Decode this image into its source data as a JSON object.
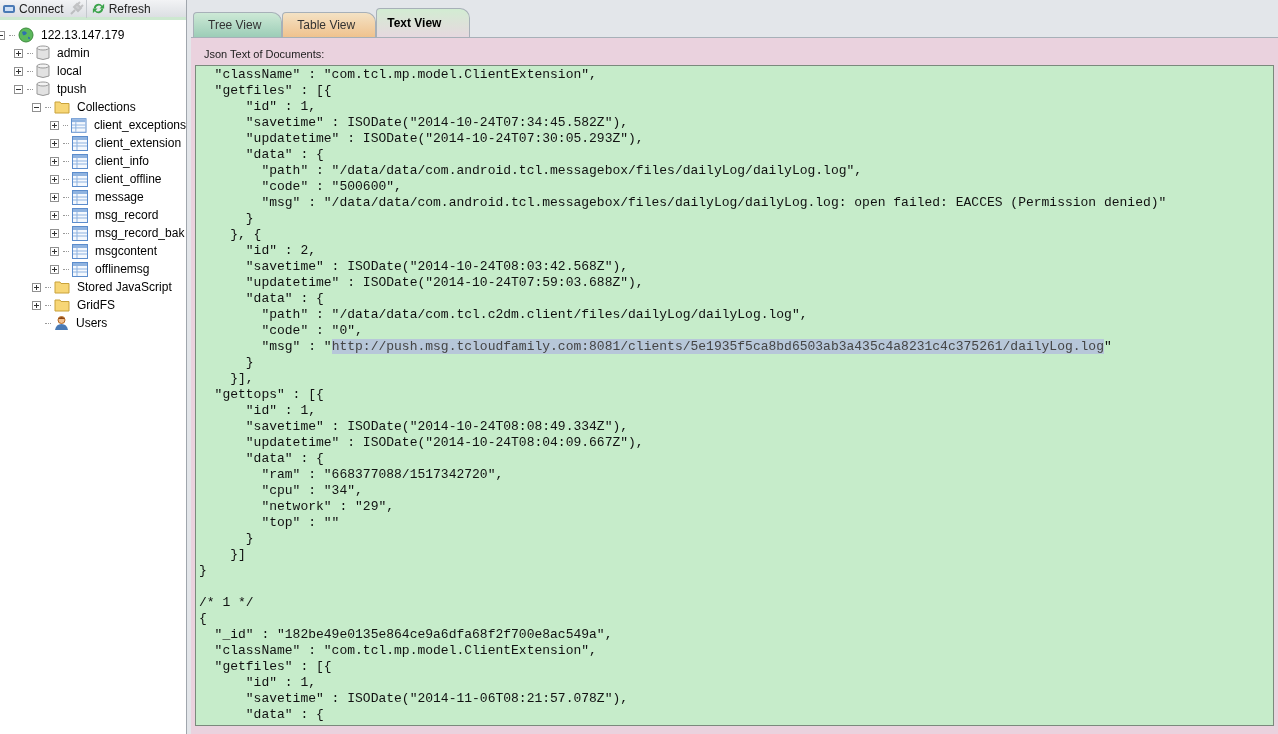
{
  "toolbar": [
    {
      "kind": "connect",
      "label": "Connect",
      "disabled": false
    },
    {
      "kind": "disconnect",
      "disabled": true
    },
    {
      "kind": "refresh",
      "label": "Refresh",
      "disabled": false
    }
  ],
  "tree": [
    {
      "label": "122.13.147.179",
      "kind": "server",
      "expanded": true,
      "children": [
        {
          "label": "admin",
          "kind": "database",
          "expanded": false
        },
        {
          "label": "local",
          "kind": "database",
          "expanded": false
        },
        {
          "label": "tpush",
          "kind": "database",
          "expanded": true,
          "children": [
            {
              "label": "Collections",
              "kind": "folder",
              "expanded": true,
              "children": [
                {
                  "label": "client_exceptions",
                  "kind": "collection",
                  "expanded": false
                },
                {
                  "label": "client_extension",
                  "kind": "collection",
                  "expanded": false
                },
                {
                  "label": "client_info",
                  "kind": "collection",
                  "expanded": false
                },
                {
                  "label": "client_offline",
                  "kind": "collection",
                  "expanded": false
                },
                {
                  "label": "message",
                  "kind": "collection",
                  "expanded": false
                },
                {
                  "label": "msg_record",
                  "kind": "collection",
                  "expanded": false
                },
                {
                  "label": "msg_record_bak",
                  "kind": "collection",
                  "expanded": false
                },
                {
                  "label": "msgcontent",
                  "kind": "collection",
                  "expanded": false
                },
                {
                  "label": "offlinemsg",
                  "kind": "collection",
                  "expanded": false
                }
              ]
            },
            {
              "label": "Stored JavaScript",
              "kind": "folder",
              "expanded": false
            },
            {
              "label": "GridFS",
              "kind": "folder",
              "expanded": false
            },
            {
              "label": "Users",
              "kind": "users"
            }
          ]
        }
      ]
    }
  ],
  "tabs": [
    {
      "label": "Tree View",
      "kind": "tree",
      "selected": false
    },
    {
      "label": "Table View",
      "kind": "table",
      "selected": false
    },
    {
      "label": "Text View",
      "kind": "text",
      "selected": true
    }
  ],
  "panel_label": "Json Text of Documents:",
  "lines": [
    {
      "text": "  \"className\" : \"com.tcl.mp.model.ClientExtension\","
    },
    {
      "text": "  \"getfiles\" : [{"
    },
    {
      "text": "      \"id\" : 1,"
    },
    {
      "text": "      \"savetime\" : ISODate(\"2014-10-24T07:34:45.582Z\"),"
    },
    {
      "text": "      \"updatetime\" : ISODate(\"2014-10-24T07:30:05.293Z\"),"
    },
    {
      "text": "      \"data\" : {"
    },
    {
      "text": "        \"path\" : \"/data/data/com.android.tcl.messagebox/files/dailyLog/dailyLog.log\","
    },
    {
      "text": "        \"code\" : \"500600\","
    },
    {
      "text": "        \"msg\" : \"/data/data/com.android.tcl.messagebox/files/dailyLog/dailyLog.log: open failed: EACCES (Permission denied)\""
    },
    {
      "text": "      }"
    },
    {
      "text": "    }, {"
    },
    {
      "text": "      \"id\" : 2,"
    },
    {
      "text": "      \"savetime\" : ISODate(\"2014-10-24T08:03:42.568Z\"),"
    },
    {
      "text": "      \"updatetime\" : ISODate(\"2014-10-24T07:59:03.688Z\"),"
    },
    {
      "text": "      \"data\" : {"
    },
    {
      "text": "        \"path\" : \"/data/data/com.tcl.c2dm.client/files/dailyLog/dailyLog.log\","
    },
    {
      "text": "        \"code\" : \"0\","
    },
    {
      "text": "        \"msg\" : \"",
      "selection": "http://push.msg.tcloudfamily.com:8081/clients/5e1935f5ca8bd6503ab3a435c4a8231c4c375261/dailyLog.log",
      "after": "\""
    },
    {
      "text": "      }"
    },
    {
      "text": "    }],"
    },
    {
      "text": "  \"gettops\" : [{"
    },
    {
      "text": "      \"id\" : 1,"
    },
    {
      "text": "      \"savetime\" : ISODate(\"2014-10-24T08:08:49.334Z\"),"
    },
    {
      "text": "      \"updatetime\" : ISODate(\"2014-10-24T08:04:09.667Z\"),"
    },
    {
      "text": "      \"data\" : {"
    },
    {
      "text": "        \"ram\" : \"668377088/1517342720\","
    },
    {
      "text": "        \"cpu\" : \"34\","
    },
    {
      "text": "        \"network\" : \"29\","
    },
    {
      "text": "        \"top\" : \"\""
    },
    {
      "text": "      }"
    },
    {
      "text": "    }]"
    },
    {
      "text": "}"
    },
    {
      "kind": "blank"
    },
    {
      "text": "/* 1 */"
    },
    {
      "text": "{"
    },
    {
      "text": "  \"_id\" : \"182be49e0135e864ce9a6dfa68f2f700e8ac549a\","
    },
    {
      "text": "  \"className\" : \"com.tcl.mp.model.ClientExtension\","
    },
    {
      "text": "  \"getfiles\" : [{"
    },
    {
      "text": "      \"id\" : 1,"
    },
    {
      "text": "      \"savetime\" : ISODate(\"2014-11-06T08:21:57.078Z\"),"
    },
    {
      "text": "      \"data\" : {"
    }
  ]
}
